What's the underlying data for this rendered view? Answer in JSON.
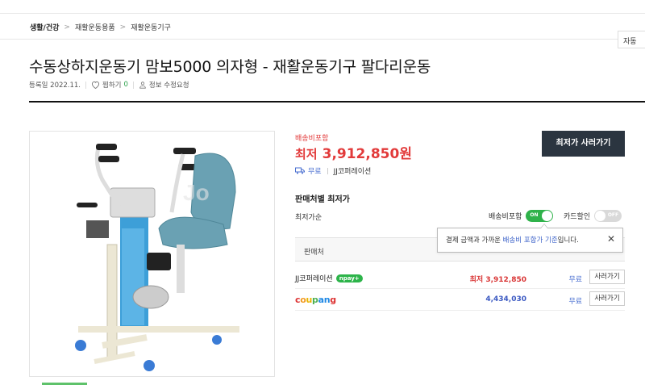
{
  "breadcrumb": {
    "items": [
      "생활/건강",
      "재활운동용품",
      "재활운동기구"
    ],
    "separator": ">"
  },
  "top_right_button": "자동",
  "product": {
    "title": "수동상하지운동기 맘보5000 의자형 - 재활운동기구 팔다리운동",
    "registered": "등록일 2022.11.",
    "zzim_label": "찜하기",
    "zzim_count": "0",
    "report_label": "정보 수정요청"
  },
  "price": {
    "shipping_included": "배송비포함",
    "lowest_label": "최저",
    "lowest_price": "3,912,850원",
    "buy_button": "최저가 사러가기",
    "free_shipping": "무료",
    "shop": "JJ코퍼레이션"
  },
  "sellers_section": {
    "title": "판매처별 최저가",
    "sort_label": "최저가순",
    "toggle_shipping_label": "배송비포함",
    "toggle_shipping_state": "ON",
    "toggle_card_label": "카드할인",
    "toggle_card_state": "OFF",
    "table_header": "판매처"
  },
  "tooltip": {
    "prefix": "결제 금액과 가까운 ",
    "link": "배송비 포함가 기준",
    "suffix": "입니다.",
    "close": "✕"
  },
  "sellers": [
    {
      "name": "JJ코퍼레이션",
      "badge": "npay+",
      "price": "최저 3,912,850",
      "shipping": "무료",
      "button": "사러가기"
    },
    {
      "name": "coupang",
      "badge": "",
      "price": "4,434,030",
      "shipping": "무료",
      "button": "사러가기"
    }
  ],
  "colors": {
    "accent_red": "#e23a3a",
    "link_blue": "#4a6fd1",
    "toggle_on": "#2fb24a",
    "buy_button_bg": "#2b3540"
  },
  "icons": [
    "heart-icon",
    "user-report-icon",
    "truck-icon",
    "close-icon"
  ]
}
